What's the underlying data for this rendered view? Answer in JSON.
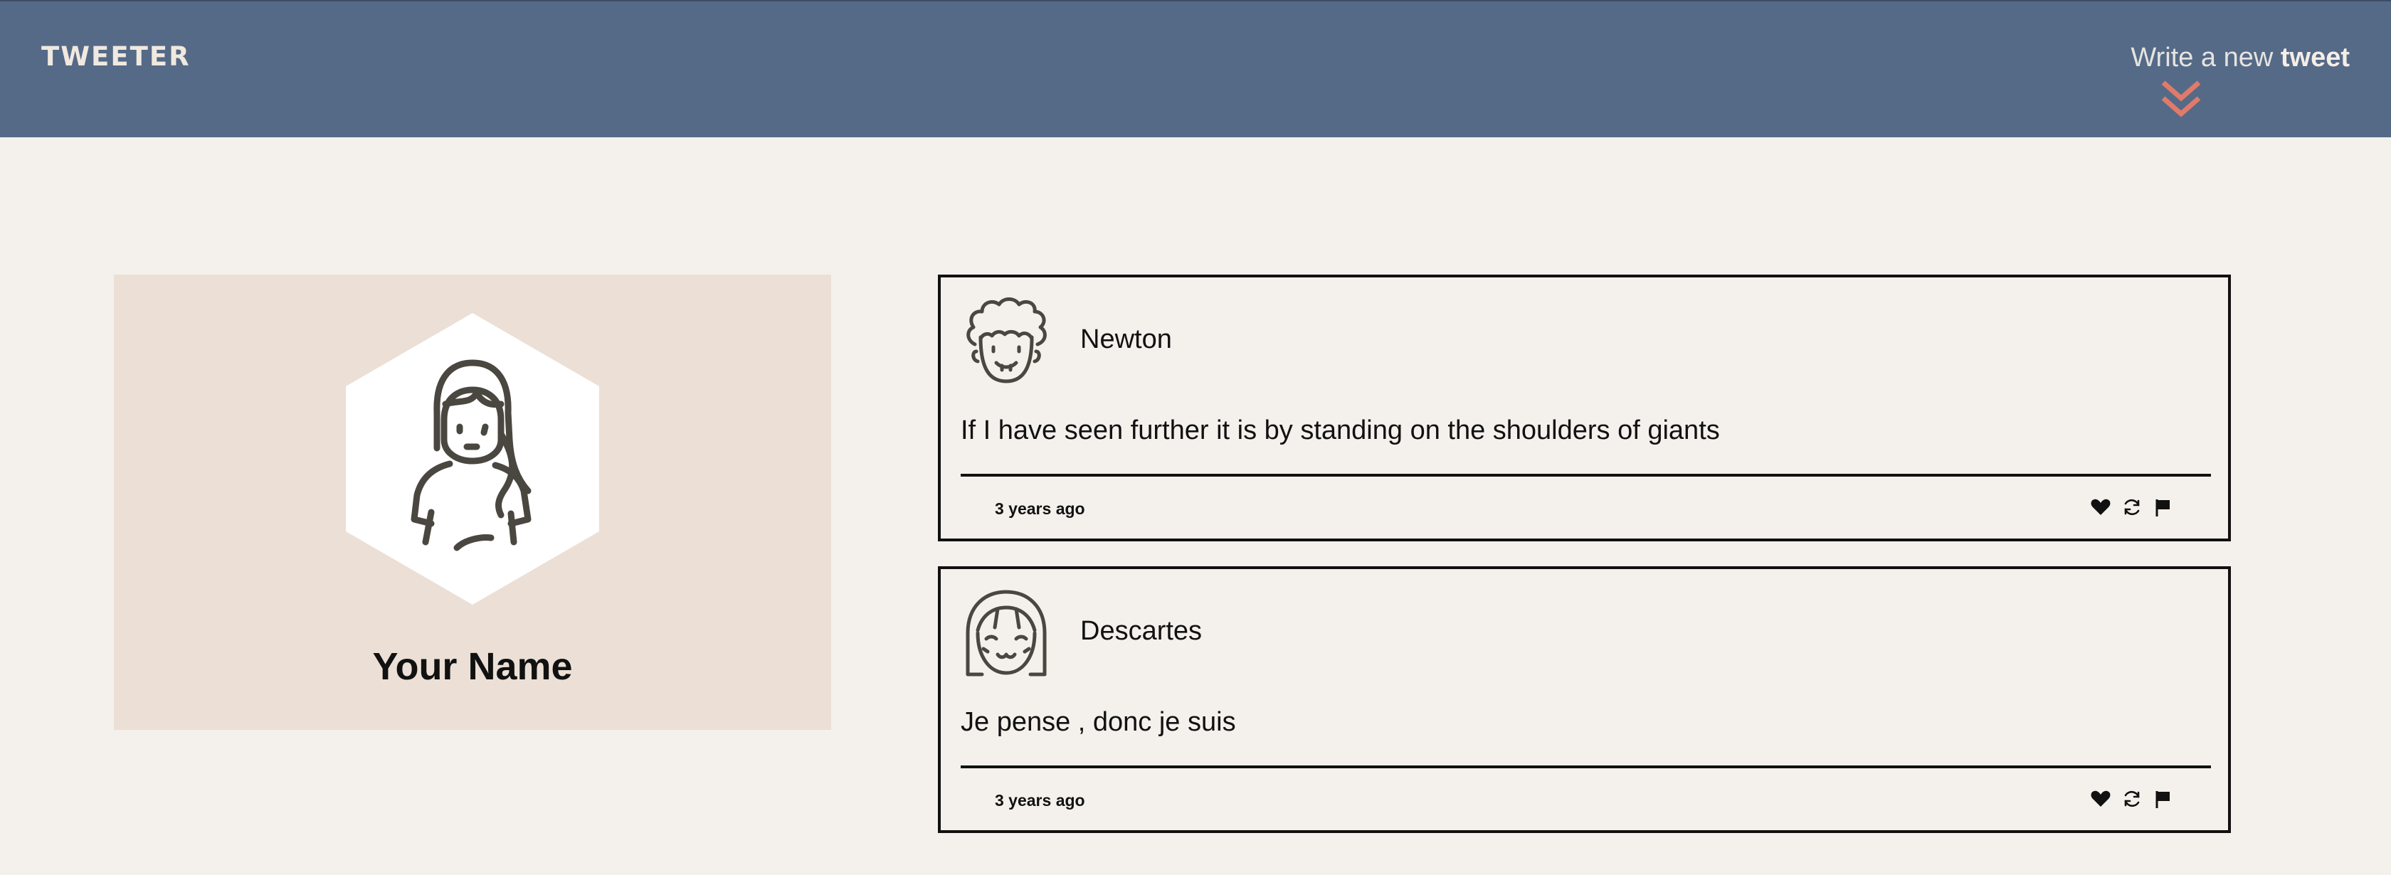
{
  "nav": {
    "brand": "TWEETER",
    "compose_light": "Write a new ",
    "compose_bold": "tweet",
    "chevron_icon": "double-chevron-down-icon",
    "accent_color": "#e07a6b",
    "bg_color": "#546a87"
  },
  "profile": {
    "name": "Your Name",
    "avatar_icon": "user-avatar-icon",
    "bg_color": "#ebdfd6"
  },
  "tweets": [
    {
      "author": "Newton",
      "text": "If I have seen further it is by standing on the shoulders of giants",
      "time": "3 years ago",
      "avatar_icon": "curly-hair-avatar-icon",
      "actions": [
        "heart-icon",
        "retweet-icon",
        "flag-icon"
      ]
    },
    {
      "author": "Descartes",
      "text": "Je pense , donc je suis",
      "time": "3 years ago",
      "avatar_icon": "bangs-avatar-icon",
      "actions": [
        "heart-icon",
        "retweet-icon",
        "flag-icon"
      ]
    }
  ]
}
